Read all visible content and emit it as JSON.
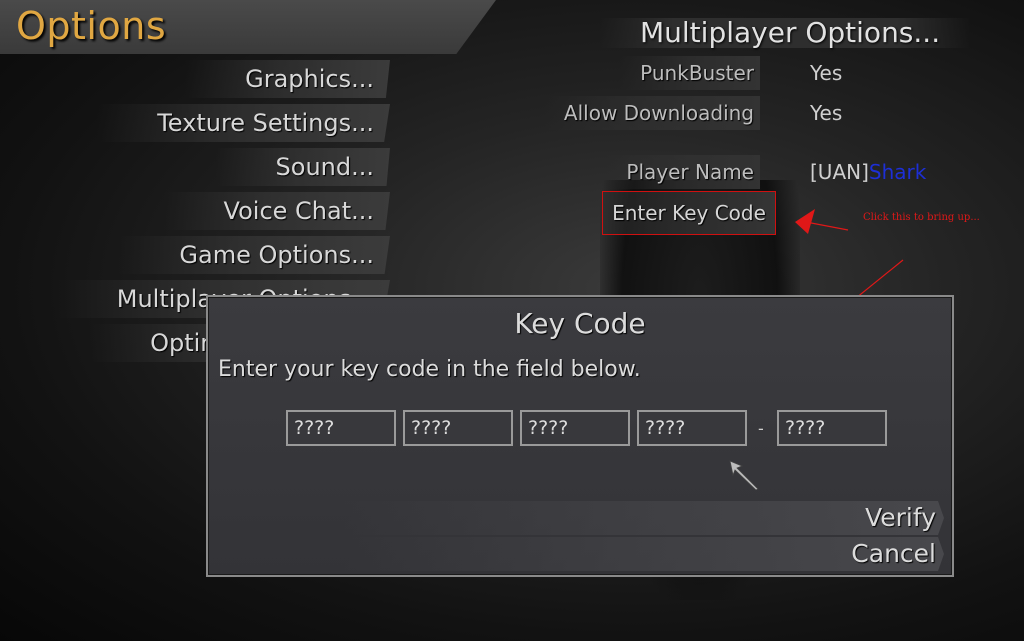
{
  "page": {
    "title": "Options"
  },
  "menu": {
    "items": [
      {
        "label": "Graphics..."
      },
      {
        "label": "Texture Settings..."
      },
      {
        "label": "Sound..."
      },
      {
        "label": "Voice Chat..."
      },
      {
        "label": "Game Options..."
      },
      {
        "label": "Multiplayer Options..."
      },
      {
        "label": "Optimal Settings..."
      }
    ]
  },
  "multiplayer": {
    "title": "Multiplayer Options...",
    "punkbuster": {
      "label": "PunkBuster",
      "value": "Yes"
    },
    "allow_downloading": {
      "label": "Allow Downloading",
      "value": "Yes"
    },
    "player_name": {
      "label": "Player Name",
      "clan_tag": "[UAN]",
      "name": "Shark"
    },
    "key_code_button": "Enter Key Code"
  },
  "annotation": {
    "text": "Click this to bring up..."
  },
  "dialog": {
    "title": "Key Code",
    "instruction": "Enter your key code in the field below.",
    "fields": [
      "????",
      "????",
      "????",
      "????",
      "????"
    ],
    "separator": "-",
    "verify_label": "Verify",
    "cancel_label": "Cancel"
  },
  "colors": {
    "title_accent": "#e0a742",
    "annotation_red": "#e01818",
    "player_name_blue": "#1d2fd6"
  }
}
